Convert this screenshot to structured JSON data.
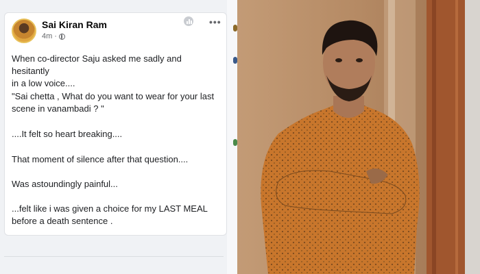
{
  "post": {
    "author": "Sai Kiran Ram",
    "time": "4m",
    "paragraphs": [
      "When co-director Saju asked me sadly and hesitantly\nin a low voice....",
      "\"Sai chetta , What do you want to wear for your last\nscene in vanambadi ? \"",
      "....It felt so heart breaking....",
      "That moment of silence after that question....",
      "Was astoundingly painful...",
      "...felt  like i was given a choice for my LAST MEAL\nbefore a death sentence ."
    ],
    "icons": [
      "avatar",
      "globe-icon",
      "insights-icon",
      "more-options-icon"
    ]
  },
  "photo": {
    "subject": "man in orange printed kurta with crossed arms",
    "colors": {
      "wall": "#b58a64",
      "kurta": "#c8762c",
      "door": "#a0562e"
    }
  }
}
